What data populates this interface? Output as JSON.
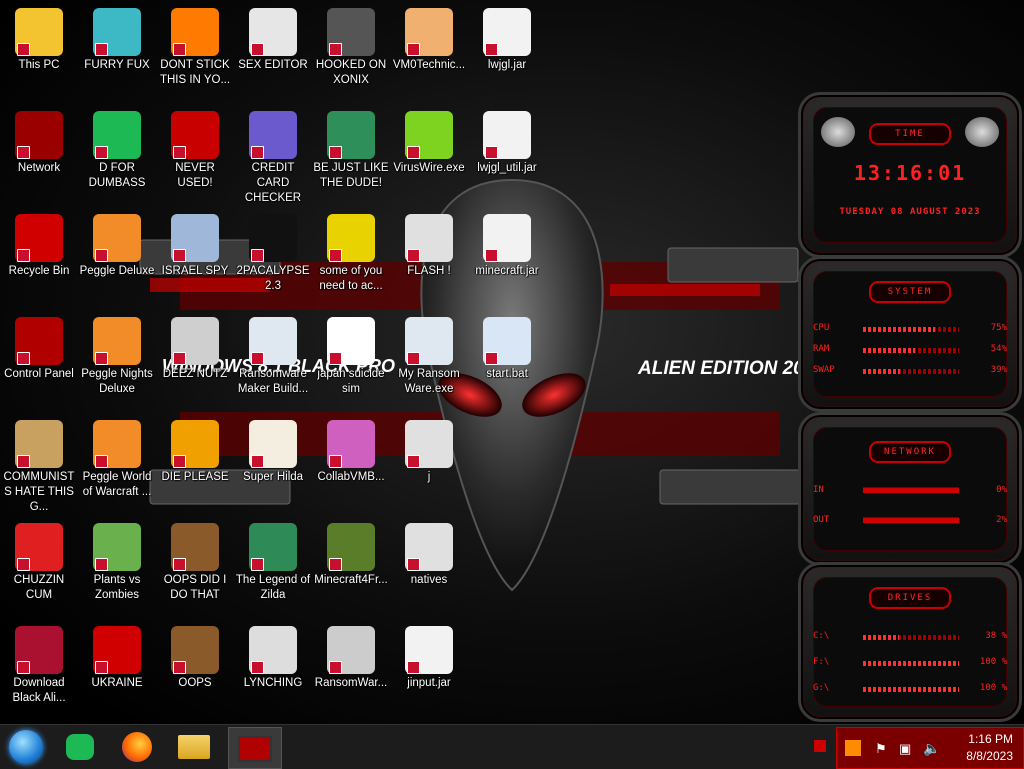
{
  "desktop": {
    "wallpaper_texts": [
      "WINDOWS 8.1 BLACK PRO",
      "ALIEN EDITION 20"
    ],
    "icons": [
      {
        "label": "This PC",
        "icon": "cartoon-face-icon",
        "color": "#f4c430"
      },
      {
        "label": "FURRY FUX",
        "icon": "cartoon-character-icon",
        "color": "#3cb9c4"
      },
      {
        "label": "DONT STICK THIS IN YO...",
        "icon": "traffic-cone-icon",
        "color": "#ff7a00"
      },
      {
        "label": "SEX EDITOR",
        "icon": "editor-app-icon",
        "color": "#e6e6e6"
      },
      {
        "label": "HOOKED ON XONIX",
        "icon": "xonix-game-icon",
        "color": "#555555"
      },
      {
        "label": "VM0Technic...",
        "icon": "person-icon",
        "color": "#f0b070"
      },
      {
        "label": "lwjgl.jar",
        "icon": "java-jar-icon",
        "color": "#f2f2f2"
      },
      {
        "label": "Network",
        "icon": "network-icon",
        "color": "#9a0000"
      },
      {
        "label": "D FOR DUMBASS",
        "icon": "chat-app-icon",
        "color": "#1db954"
      },
      {
        "label": "NEVER USED!",
        "icon": "dev-cpp-icon",
        "color": "#c80000"
      },
      {
        "label": "CREDIT CARD CHECKER",
        "icon": "credit-card-icon",
        "color": "#6a5acd"
      },
      {
        "label": "BE JUST LIKE THE DUDE!",
        "icon": "santa-elf-icon",
        "color": "#2f8f5b"
      },
      {
        "label": "VirusWire.exe",
        "icon": "lime-icon",
        "color": "#7ed321"
      },
      {
        "label": "lwjgl_util.jar",
        "icon": "java-jar-icon",
        "color": "#f2f2f2"
      },
      {
        "label": "Recycle Bin",
        "icon": "recycle-bin-icon",
        "color": "#d00000"
      },
      {
        "label": "Peggle Deluxe",
        "icon": "peggle-icon",
        "color": "#f28c28"
      },
      {
        "label": "ISRAEL SPY",
        "icon": "spy-device-icon",
        "color": "#9fb7d8"
      },
      {
        "label": "2PACALYPSE 2.3",
        "icon": "terminal-icon",
        "color": "#111111"
      },
      {
        "label": "some of you need to ac...",
        "icon": "beaver-icon",
        "color": "#e8d200"
      },
      {
        "label": "FLASH !",
        "icon": "file-icon",
        "color": "#e0e0e0"
      },
      {
        "label": "minecraft.jar",
        "icon": "java-jar-icon",
        "color": "#f2f2f2"
      },
      {
        "label": "Control Panel",
        "icon": "control-panel-icon",
        "color": "#b00000"
      },
      {
        "label": "Peggle Nights Deluxe",
        "icon": "peggle-icon",
        "color": "#f28c28"
      },
      {
        "label": "DEEZ NUTZ",
        "icon": "window-stack-icon",
        "color": "#cfcfcf"
      },
      {
        "label": "Ransomware Maker Build...",
        "icon": "app-window-icon",
        "color": "#dfe8f0"
      },
      {
        "label": "japan suicide sim",
        "icon": "game-file-icon",
        "color": "#ffffff"
      },
      {
        "label": "My Ransom Ware.exe",
        "icon": "app-window-icon",
        "color": "#dfe8f0"
      },
      {
        "label": "start.bat",
        "icon": "batch-gear-icon",
        "color": "#d8e6f5"
      },
      {
        "label": "COMMUNISTS HATE THIS G...",
        "icon": "money-bag-icon",
        "color": "#c8a060"
      },
      {
        "label": "Peggle World of Warcraft ...",
        "icon": "peggle-icon",
        "color": "#f28c28"
      },
      {
        "label": "DIE PLEASE",
        "icon": "de-icon",
        "color": "#f0a000"
      },
      {
        "label": "Super Hilda",
        "icon": "pixel-dog-icon",
        "color": "#f3eee0"
      },
      {
        "label": "CollabVMB...",
        "icon": "collabvm-icon",
        "color": "#d060c0"
      },
      {
        "label": "j",
        "icon": "file-icon",
        "color": "#e0e0e0"
      },
      {
        "label": "CHUZZIN CUM",
        "icon": "chuzzle-icon",
        "color": "#e02020"
      },
      {
        "label": "Plants vs Zombies",
        "icon": "flower-icon",
        "color": "#6ab04c"
      },
      {
        "label": "OOPS DID I DO THAT",
        "icon": "portrait-icon",
        "color": "#8b5a2b"
      },
      {
        "label": "The Legend of Zilda",
        "icon": "pixel-hero-icon",
        "color": "#2e8b57"
      },
      {
        "label": "Minecraft4Fr...",
        "icon": "grass-block-icon",
        "color": "#5a7d2a"
      },
      {
        "label": "natives",
        "icon": "file-icon",
        "color": "#e0e0e0"
      },
      {
        "label": "Download Black Ali...",
        "icon": "alien-ball-icon",
        "color": "#aa1030"
      },
      {
        "label": "UKRAINE",
        "icon": "radiation-icon",
        "color": "#d00000"
      },
      {
        "label": "OOPS",
        "icon": "portrait-icon",
        "color": "#8b5a2b"
      },
      {
        "label": "LYNCHING",
        "icon": "noose-icon",
        "color": "#dddddd"
      },
      {
        "label": "RansomWar...",
        "icon": "skull-icon",
        "color": "#cccccc"
      },
      {
        "label": "jinput.jar",
        "icon": "java-jar-icon",
        "color": "#f2f2f2"
      }
    ]
  },
  "gadgets": {
    "time": {
      "title": "TIME",
      "clock": "13:16:01",
      "date": "TUESDAY 08 AUGUST 2023"
    },
    "system": {
      "title": "SYSTEM",
      "rows": [
        {
          "key": "CPU",
          "value": "75%",
          "level": 0.75
        },
        {
          "key": "RAM",
          "value": "54%",
          "level": 0.54
        },
        {
          "key": "SWAP",
          "value": "39%",
          "level": 0.39
        }
      ]
    },
    "network": {
      "title": "NETWORK",
      "rows": [
        {
          "key": "IN",
          "value": "0%"
        },
        {
          "key": "OUT",
          "value": "2%"
        }
      ]
    },
    "drives": {
      "title": "DRIVES",
      "rows": [
        {
          "key": "C:\\",
          "value": "38 %",
          "level": 0.38
        },
        {
          "key": "F:\\",
          "value": "100 %",
          "level": 1.0
        },
        {
          "key": "G:\\",
          "value": "100 %",
          "level": 1.0
        }
      ]
    }
  },
  "taskbar": {
    "pinned": [
      {
        "name": "start-orb",
        "icon": "windows-orb-icon"
      },
      {
        "name": "chat-app",
        "icon": "chat-app-icon"
      },
      {
        "name": "firefox",
        "icon": "firefox-icon"
      },
      {
        "name": "file-explorer",
        "icon": "folder-icon"
      },
      {
        "name": "active-window",
        "icon": "control-panel-icon"
      }
    ],
    "clock": {
      "time": "1:16 PM",
      "date": "8/8/2023"
    }
  }
}
